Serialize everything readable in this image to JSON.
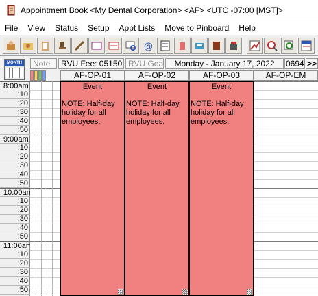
{
  "window": {
    "title": "Appointment Book <My Dental Corporation> <AF> <UTC -07:00 [MST]>"
  },
  "menu": [
    "File",
    "View",
    "Status",
    "Setup",
    "Appt Lists",
    "Move to Pinboard",
    "Help"
  ],
  "toolbar": {
    "left_icons": [
      "dentist-icon",
      "patient-folder-icon",
      "clipboard-icon",
      "chair-icon",
      "instrument-icon",
      "card-icon",
      "note-card-icon",
      "search-card-icon",
      "email-icon",
      "checklist-icon",
      "cup-icon",
      "lab-case-icon",
      "book-icon",
      "phone-icon"
    ],
    "right_icons": [
      "chart-icon",
      "magnify-icon",
      "zoom-chart-icon",
      "appt-list-icon"
    ]
  },
  "infobar": {
    "note_label": "Note",
    "rvu_fee": "RVU Fee: 05150",
    "rvu_goal": "RVU Goal",
    "date": "Monday - January 17, 2022",
    "counter": "0694",
    "next_label": ">>"
  },
  "calendar_button": {
    "label": "MONTH"
  },
  "color_swatches": [
    "#ff8080",
    "#ffd24a",
    "#6fc26f",
    "#6aa0ff"
  ],
  "columns": [
    "AF-OP-01",
    "AF-OP-02",
    "AF-OP-03",
    "AF-OP-EM"
  ],
  "time_slots": [
    "8:00am",
    ":10",
    ":20",
    ":30",
    ":40",
    ":50",
    "9:00am",
    ":10",
    ":20",
    ":30",
    ":40",
    ":50",
    "10:00am",
    ":10",
    ":20",
    ":30",
    ":40",
    ":50",
    "11:00am",
    ":10",
    ":20",
    ":30",
    ":40",
    ":50"
  ],
  "events": [
    {
      "title": "Event",
      "note": "NOTE: Half-day holiday for all employees."
    },
    {
      "title": "Event",
      "note": "NOTE: Half-day holiday for all employees."
    },
    {
      "title": "Event",
      "note": "NOTE: Half-day holiday for all employees."
    }
  ],
  "colors": {
    "event_fill": "#f18080",
    "title_bar": "#ffffff"
  }
}
